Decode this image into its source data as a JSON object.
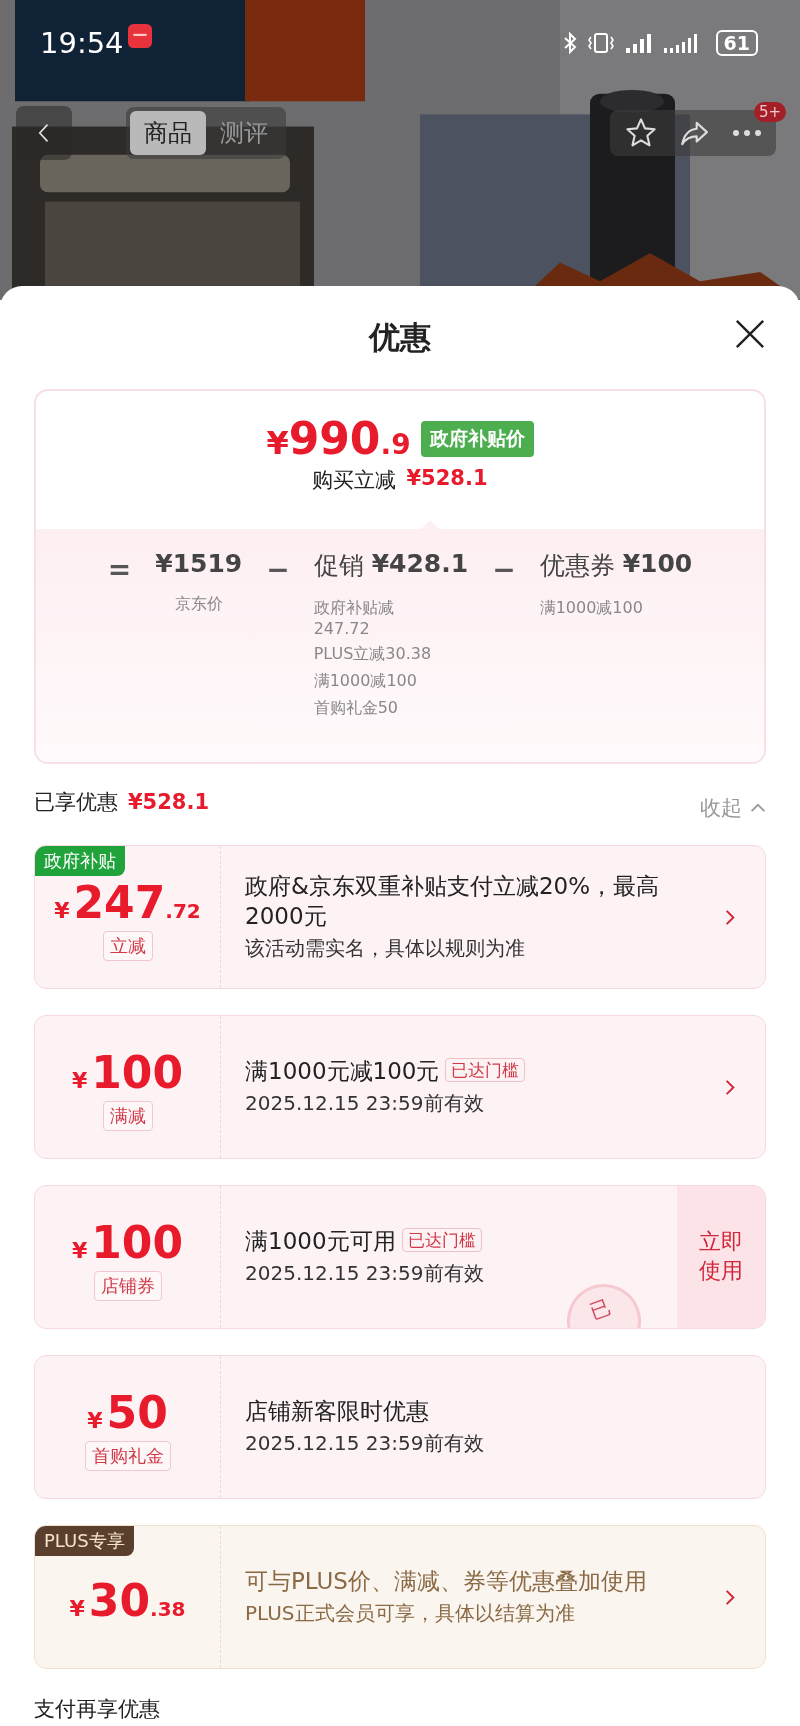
{
  "status_bar": {
    "time": "19:54",
    "battery": "61"
  },
  "nav": {
    "tabs": [
      {
        "label": "商品",
        "selected": true
      },
      {
        "label": "测评",
        "selected": false
      }
    ],
    "more_badge": "5+"
  },
  "sheet": {
    "title": "优惠",
    "price_card": {
      "currency": "¥",
      "price_int": "990",
      "price_dec": ".9",
      "price_tag": "政府补贴价",
      "saving_label": "购买立减",
      "saving_amount": "¥528.1",
      "terms": [
        {
          "op": "=",
          "amount": "¥1519",
          "notes": [
            "京东价"
          ],
          "kind": "plain"
        },
        {
          "op": "−",
          "label": "促销",
          "amount": "¥428.1",
          "notes": [
            "政府补贴减247.72",
            "PLUS立减30.38",
            "满1000减100",
            "首购礼金50"
          ],
          "kind": "list"
        },
        {
          "op": "−",
          "label": "优惠券",
          "amount": "¥100",
          "notes": [
            "满1000减100"
          ],
          "kind": "list"
        }
      ]
    },
    "enjoyed": {
      "label": "已享优惠",
      "amount": "¥528.1",
      "toggle": "收起",
      "expanded": true
    },
    "coupons": [
      {
        "kind": "gov",
        "tag": "政府补贴",
        "currency": "¥",
        "amount_int": "247",
        "amount_dec": ".72",
        "unit": "立减",
        "title": "政府&京东双重补贴支付立减20%，最高2000元",
        "subtitle": "该活动需实名，具体以规则为准",
        "action": {
          "kind": "arrow"
        }
      },
      {
        "kind": "normal",
        "currency": "¥",
        "amount_int": "100",
        "unit": "满减",
        "title": "满1000元减100元",
        "badge": "已达门槛",
        "subtitle": "2025.12.15 23:59前有效",
        "action": {
          "kind": "arrow"
        }
      },
      {
        "kind": "shop",
        "currency": "¥",
        "amount_int": "100",
        "unit": "店铺券",
        "title": "满1000元可用",
        "badge": "已达门槛",
        "subtitle": "2025.12.15 23:59前有效",
        "action": {
          "kind": "button",
          "label": "立即使用"
        },
        "stamp": "已"
      },
      {
        "kind": "normal",
        "currency": "¥",
        "amount_int": "50",
        "unit": "首购礼金",
        "title": "店铺新客限时优惠",
        "subtitle": "2025.12.15 23:59前有效",
        "action": {
          "kind": "none"
        }
      },
      {
        "kind": "plus",
        "tag": "PLUS专享",
        "currency": "¥",
        "amount_int": "30",
        "amount_dec": ".38",
        "title": "可与PLUS价、满减、券等优惠叠加使用",
        "subtitle": "PLUS正式会员可享，具体以结算为准",
        "action": {
          "kind": "arrow"
        }
      }
    ],
    "footer": "支付再享优惠"
  }
}
